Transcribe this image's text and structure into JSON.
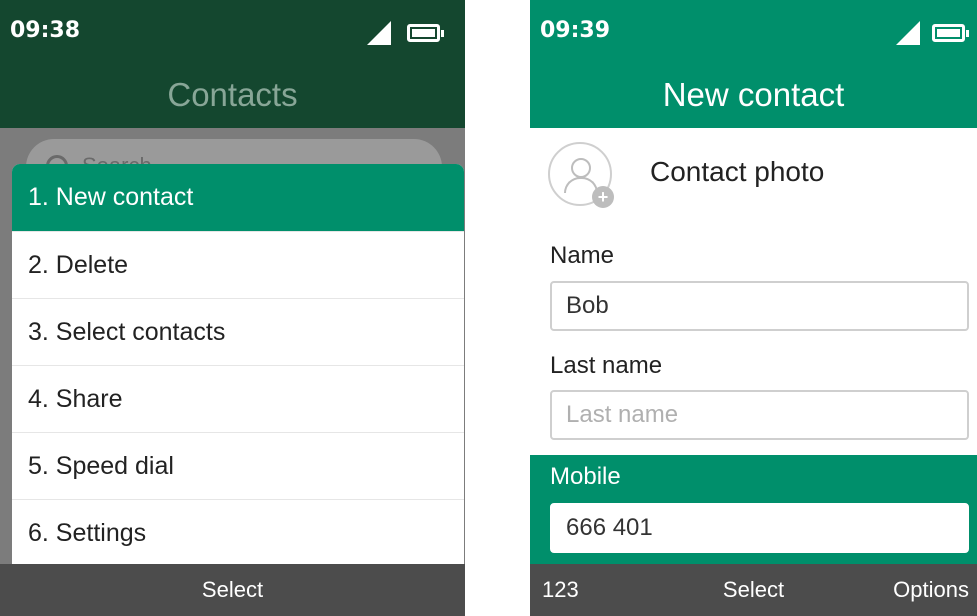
{
  "left_screen": {
    "status": {
      "time": "09:38"
    },
    "title": "Contacts",
    "search_placeholder": "Search",
    "menu_items": [
      "1. New contact",
      "2. Delete",
      "3. Select contacts",
      "4. Share",
      "5. Speed dial",
      "6. Settings"
    ],
    "selected_index": 0,
    "softkeys": {
      "center": "Select"
    }
  },
  "right_screen": {
    "status": {
      "time": "09:39"
    },
    "title": "New contact",
    "photo_label": "Contact photo",
    "name_label": "Name",
    "name_value": "Bob",
    "last_name_label": "Last name",
    "last_name_placeholder": "Last name",
    "mobile_label": "Mobile",
    "mobile_value": "666 401",
    "softkeys": {
      "left": "123",
      "center": "Select",
      "right": "Options"
    }
  },
  "colors": {
    "dark_green": "#14472f",
    "accent_green": "#008f6b",
    "softkey_bar": "#4c4c4c"
  },
  "icons": [
    "signal-icon",
    "battery-icon",
    "search-icon",
    "avatar-icon",
    "add-photo-icon"
  ]
}
